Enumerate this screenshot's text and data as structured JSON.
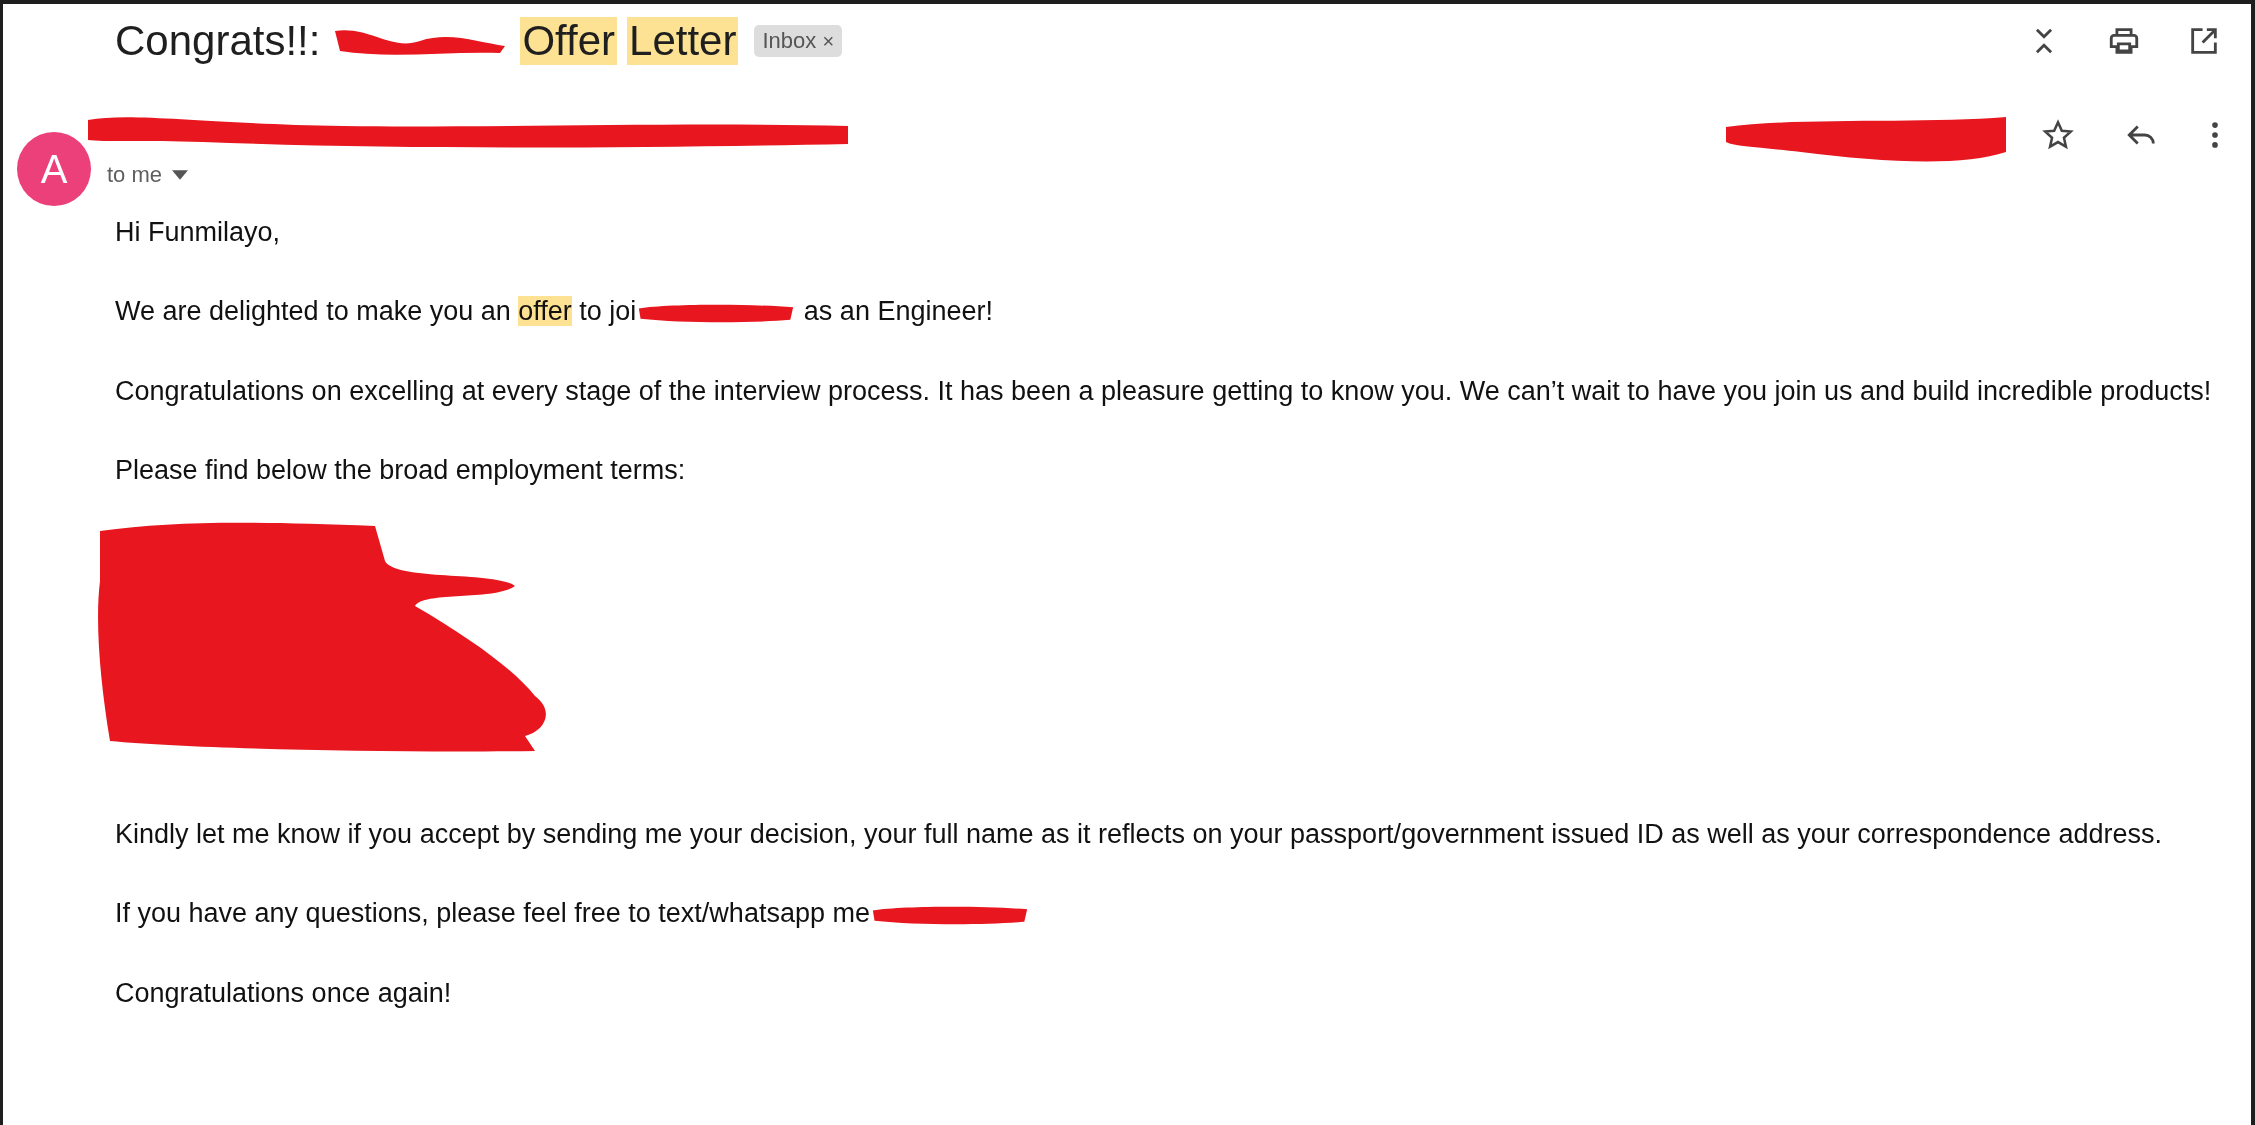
{
  "subject": [
    {
      "kind": "text",
      "text": "Congrats!!:",
      "highlighted": false
    },
    {
      "kind": "redacted"
    },
    {
      "kind": "text",
      "text": "Offer",
      "highlighted": true
    },
    {
      "kind": "text",
      "text": "Letter",
      "highlighted": true
    }
  ],
  "label": {
    "text": "Inbox",
    "close": "×"
  },
  "sender": {
    "avatar": "A",
    "recipient": "to me"
  },
  "body": [
    {
      "kind": "text",
      "segments": [
        {
          "kind": "text",
          "text": "Hi Funmilayo,",
          "highlighted": false
        }
      ]
    },
    {
      "kind": "text",
      "segments": [
        {
          "kind": "text",
          "text": "We are delighted to make you an ",
          "highlighted": false
        },
        {
          "kind": "text",
          "text": "offer",
          "highlighted": true
        },
        {
          "kind": "text",
          "text": " to joi",
          "highlighted": false
        },
        {
          "kind": "redacted"
        },
        {
          "kind": "text",
          "text": " as an Engineer!",
          "highlighted": false
        }
      ]
    },
    {
      "kind": "text",
      "segments": [
        {
          "kind": "text",
          "text": "Congratulations on excelling at every stage of the interview process. It has been a pleasure getting to know you. We can’t wait to have you join us and build incredible products!",
          "highlighted": false
        }
      ]
    },
    {
      "kind": "text",
      "segments": [
        {
          "kind": "text",
          "text": "Please find below the broad employment terms:",
          "highlighted": false
        }
      ]
    },
    {
      "kind": "redacted"
    },
    {
      "kind": "text",
      "segments": [
        {
          "kind": "text",
          "text": "Kindly let me know if you accept by sending me your decision, your full name as it reflects on your passport/government issued ID as well as your correspondence address.",
          "highlighted": false
        }
      ]
    },
    {
      "kind": "text",
      "segments": [
        {
          "kind": "text",
          "text": "If you have any questions, please feel free to text/whatsapp me",
          "highlighted": false
        },
        {
          "kind": "redacted"
        }
      ]
    },
    {
      "kind": "text",
      "segments": [
        {
          "kind": "text",
          "text": "Congratulations once again!",
          "highlighted": false
        }
      ]
    }
  ]
}
